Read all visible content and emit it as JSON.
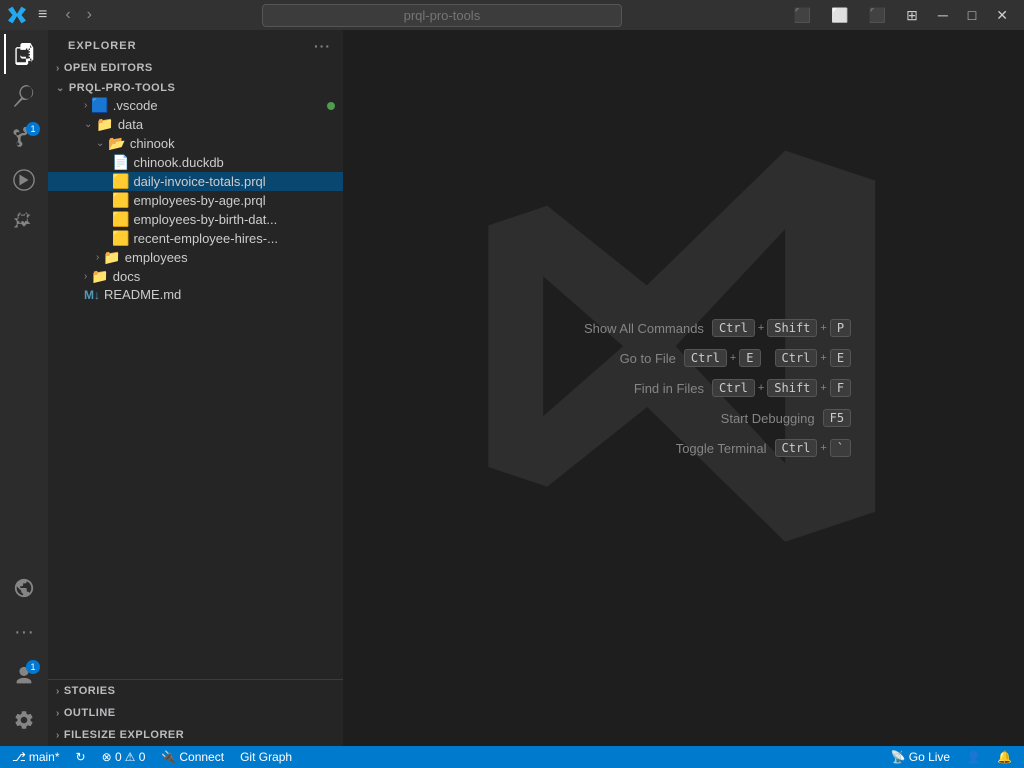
{
  "titlebar": {
    "search_placeholder": "prql-pro-tools",
    "nav_back": "‹",
    "nav_forward": "›",
    "menu_icon": "≡",
    "win_minimize": "─",
    "win_maximize": "□",
    "win_close": "✕"
  },
  "sidebar": {
    "header": "EXPLORER",
    "sections": {
      "open_editors": "OPEN EDITORS",
      "project": "PRQL-PRO-TOOLS"
    },
    "files": {
      "vscode": ".vscode",
      "data": "data",
      "chinook": "chinook",
      "chinook_db": "chinook.duckdb",
      "daily_invoice": "daily-invoice-totals.prql",
      "employees_age": "employees-by-age.prql",
      "employees_birth": "employees-by-birth-dat...",
      "recent_employee": "recent-employee-hires-...",
      "employees": "employees",
      "docs": "docs",
      "readme": "README.md"
    },
    "bottom_sections": {
      "stories": "STORIES",
      "outline": "OUTLINE",
      "filesize_explorer": "FILESIZE EXPLORER"
    }
  },
  "welcome": {
    "show_all_commands": "Show All Commands",
    "go_to_file": "Go to File",
    "find_in_files": "Find in Files",
    "start_debugging": "Start Debugging",
    "toggle_terminal": "Toggle Terminal",
    "shortcuts": {
      "show_all": [
        "Ctrl",
        "+",
        "Shift",
        "+",
        "P"
      ],
      "go_to_file_1": [
        "Ctrl",
        "+",
        "E"
      ],
      "go_to_file_2": [
        "Ctrl",
        "+",
        "E"
      ],
      "find_in_files": [
        "Ctrl",
        "+",
        "Shift",
        "+",
        "F"
      ],
      "debug": [
        "F5"
      ],
      "toggle_terminal": [
        "Ctrl",
        "+",
        "`"
      ]
    }
  },
  "statusbar": {
    "branch": "main*",
    "sync": "↻",
    "errors": "⊗ 0",
    "warnings": "⚠ 0",
    "connect": "Connect",
    "connect_icon": "🔌",
    "git_graph": "Git Graph",
    "go_live": "Go Live",
    "go_live_icon": "📡",
    "person_icon": "👤",
    "bell_icon": "🔔"
  },
  "activity": {
    "explorer": "📁",
    "search": "🔍",
    "source_control": "⎇",
    "run": "▷",
    "extensions": "⊞",
    "remote_explorer": "📺",
    "more": "···",
    "accounts": "👤",
    "settings": "⚙"
  },
  "colors": {
    "accent": "#007acc",
    "selected_bg": "#094771",
    "badge": "#0078d4"
  }
}
